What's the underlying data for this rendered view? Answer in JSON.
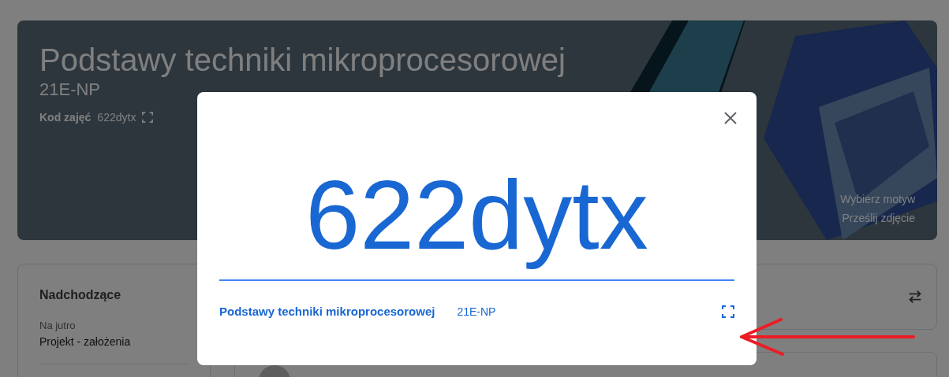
{
  "banner": {
    "title": "Podstawy techniki mikroprocesorowej",
    "section": "21E-NP",
    "code_label": "Kod zajęć",
    "code": "622dytx",
    "links": [
      "Wybierz motyw",
      "Prześlij zdjęcie"
    ]
  },
  "upcoming": {
    "title": "Nadchodzące",
    "items": [
      {
        "due": "Na jutro",
        "name": "Projekt - założenia"
      }
    ]
  },
  "dialog": {
    "code": "622dytx",
    "course": "Podstawy techniki mikroprocesorowej",
    "section": "21E-NP"
  }
}
